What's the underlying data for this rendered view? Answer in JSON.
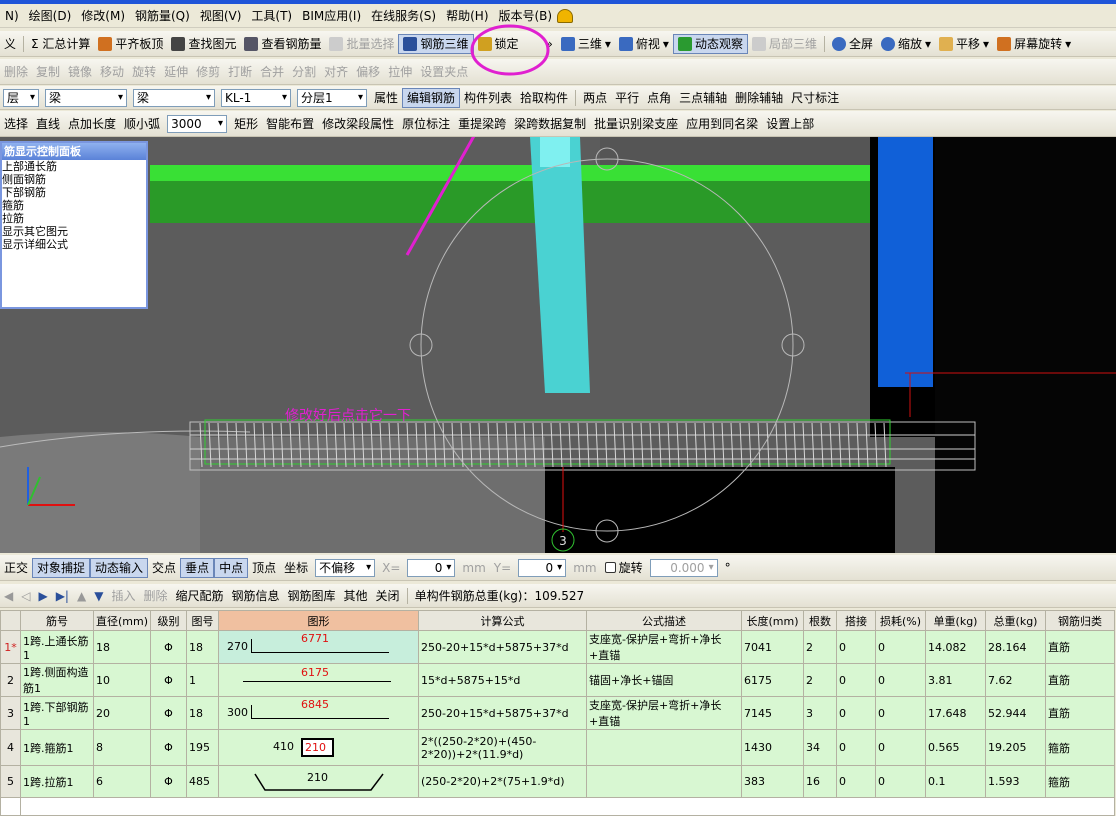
{
  "menu": [
    "N)",
    "绘图(D)",
    "修改(M)",
    "钢筋量(Q)",
    "视图(V)",
    "工具(T)",
    "BIM应用(I)",
    "在线服务(S)",
    "帮助(H)",
    "版本号(B)"
  ],
  "toolbar1": {
    "items": [
      {
        "label": "义",
        "dis": false
      },
      {
        "label": "Σ 汇总计算",
        "dis": false
      },
      {
        "label": "平齐板顶",
        "dis": false
      },
      {
        "label": "查找图元",
        "dis": false
      },
      {
        "label": "查看钢筋量",
        "dis": false
      },
      {
        "label": "批量选择",
        "dis": true
      },
      {
        "label": "钢筋三维",
        "dis": false
      },
      {
        "label": "锁定",
        "dis": false
      },
      {
        "label": "三维",
        "dis": false
      },
      {
        "label": "俯视",
        "dis": false
      },
      {
        "label": "动态观察",
        "dis": false
      },
      {
        "label": "局部三维",
        "dis": true
      },
      {
        "label": "全屏",
        "dis": false
      },
      {
        "label": "缩放",
        "dis": false
      },
      {
        "label": "平移",
        "dis": false
      },
      {
        "label": "屏幕旋转",
        "dis": false
      }
    ]
  },
  "toolbar2": {
    "items": [
      "删除",
      "复制",
      "镜像",
      "移动",
      "旋转",
      "延伸",
      "修剪",
      "打断",
      "合并",
      "分割",
      "对齐",
      "偏移",
      "拉伸",
      "设置夹点"
    ]
  },
  "toolbar3": {
    "selects": [
      {
        "value": "层"
      },
      {
        "value": "梁"
      },
      {
        "value": "梁"
      },
      {
        "value": "KL-1"
      },
      {
        "value": "分层1"
      }
    ],
    "items": [
      "属性",
      "编辑钢筋",
      "构件列表",
      "拾取构件",
      "两点",
      "平行",
      "点角",
      "三点辅轴",
      "删除辅轴",
      "尺寸标注"
    ]
  },
  "toolbar4": {
    "items": [
      "选择",
      "直线",
      "点加长度",
      "顺小弧"
    ],
    "arc_value": "3000",
    "items2": [
      "矩形",
      "智能布置",
      "修改梁段属性",
      "原位标注",
      "重提梁跨",
      "梁跨数据复制",
      "批量识别梁支座",
      "应用到同名梁",
      "设置上部"
    ]
  },
  "panel": {
    "title": "筋显示控制面板",
    "items": [
      "上部通长筋",
      "侧面钢筋",
      "下部钢筋",
      "箍筋",
      "拉筋",
      "显示其它图元",
      "显示详细公式"
    ]
  },
  "annotation": "修改好后点击它一下",
  "axis_marker": "3",
  "snapbar": {
    "items": [
      "正交",
      "对象捕捉",
      "动态输入",
      "交点",
      "垂点",
      "中点",
      "顶点",
      "坐标"
    ],
    "offset": "不偏移",
    "x_label": "X=",
    "x_value": "0",
    "y_label": "Y=",
    "y_value": "0",
    "unit": "mm",
    "rotate_label": "旋转",
    "rotate_value": "0.000",
    "deg": "°"
  },
  "gridtb": {
    "items": [
      "插入",
      "删除",
      "缩尺配筋",
      "钢筋信息",
      "钢筋图库",
      "其他",
      "关闭"
    ],
    "total": "单构件钢筋总重(kg)：109.527"
  },
  "table": {
    "headers": [
      "",
      "筋号",
      "直径(mm)",
      "级别",
      "图号",
      "图形",
      "计算公式",
      "公式描述",
      "长度(mm)",
      "根数",
      "搭接",
      "损耗(%)",
      "单重(kg)",
      "总重(kg)",
      "钢筋归类"
    ],
    "rows": [
      {
        "n": "1*",
        "name": "1跨.上通长筋1",
        "dia": "18",
        "grade": "Φ",
        "fig": "18",
        "shape_left": "270",
        "shape_val": "6771",
        "formula": "250-20+15*d+5875+37*d",
        "desc": "支座宽-保护层+弯折+净长+直锚",
        "len": "7041",
        "count": "2",
        "lap": "0",
        "loss": "0",
        "unit": "14.082",
        "total": "28.164",
        "cls": "直筋"
      },
      {
        "n": "2",
        "name": "1跨.侧面构造筋1",
        "dia": "10",
        "grade": "Φ",
        "fig": "1",
        "shape_left": "",
        "shape_val": "6175",
        "formula": "15*d+5875+15*d",
        "desc": "锚固+净长+锚固",
        "len": "6175",
        "count": "2",
        "lap": "0",
        "loss": "0",
        "unit": "3.81",
        "total": "7.62",
        "cls": "直筋"
      },
      {
        "n": "3",
        "name": "1跨.下部钢筋1",
        "dia": "20",
        "grade": "Φ",
        "fig": "18",
        "shape_left": "300",
        "shape_val": "6845",
        "formula": "250-20+15*d+5875+37*d",
        "desc": "支座宽-保护层+弯折+净长+直锚",
        "len": "7145",
        "count": "3",
        "lap": "0",
        "loss": "0",
        "unit": "17.648",
        "total": "52.944",
        "cls": "直筋"
      },
      {
        "n": "4",
        "name": "1跨.箍筋1",
        "dia": "8",
        "grade": "Φ",
        "fig": "195",
        "shape_left": "410",
        "shape_val": "210",
        "formula": "2*((250-2*20)+(450-2*20))+2*(11.9*d)",
        "desc": "",
        "len": "1430",
        "count": "34",
        "lap": "0",
        "loss": "0",
        "unit": "0.565",
        "total": "19.205",
        "cls": "箍筋"
      },
      {
        "n": "5",
        "name": "1跨.拉筋1",
        "dia": "6",
        "grade": "Φ",
        "fig": "485",
        "shape_left": "",
        "shape_val": "210",
        "formula": "(250-2*20)+2*(75+1.9*d)",
        "desc": "",
        "len": "383",
        "count": "16",
        "lap": "0",
        "loss": "0",
        "unit": "0.1",
        "total": "1.593",
        "cls": "箍筋"
      }
    ]
  }
}
